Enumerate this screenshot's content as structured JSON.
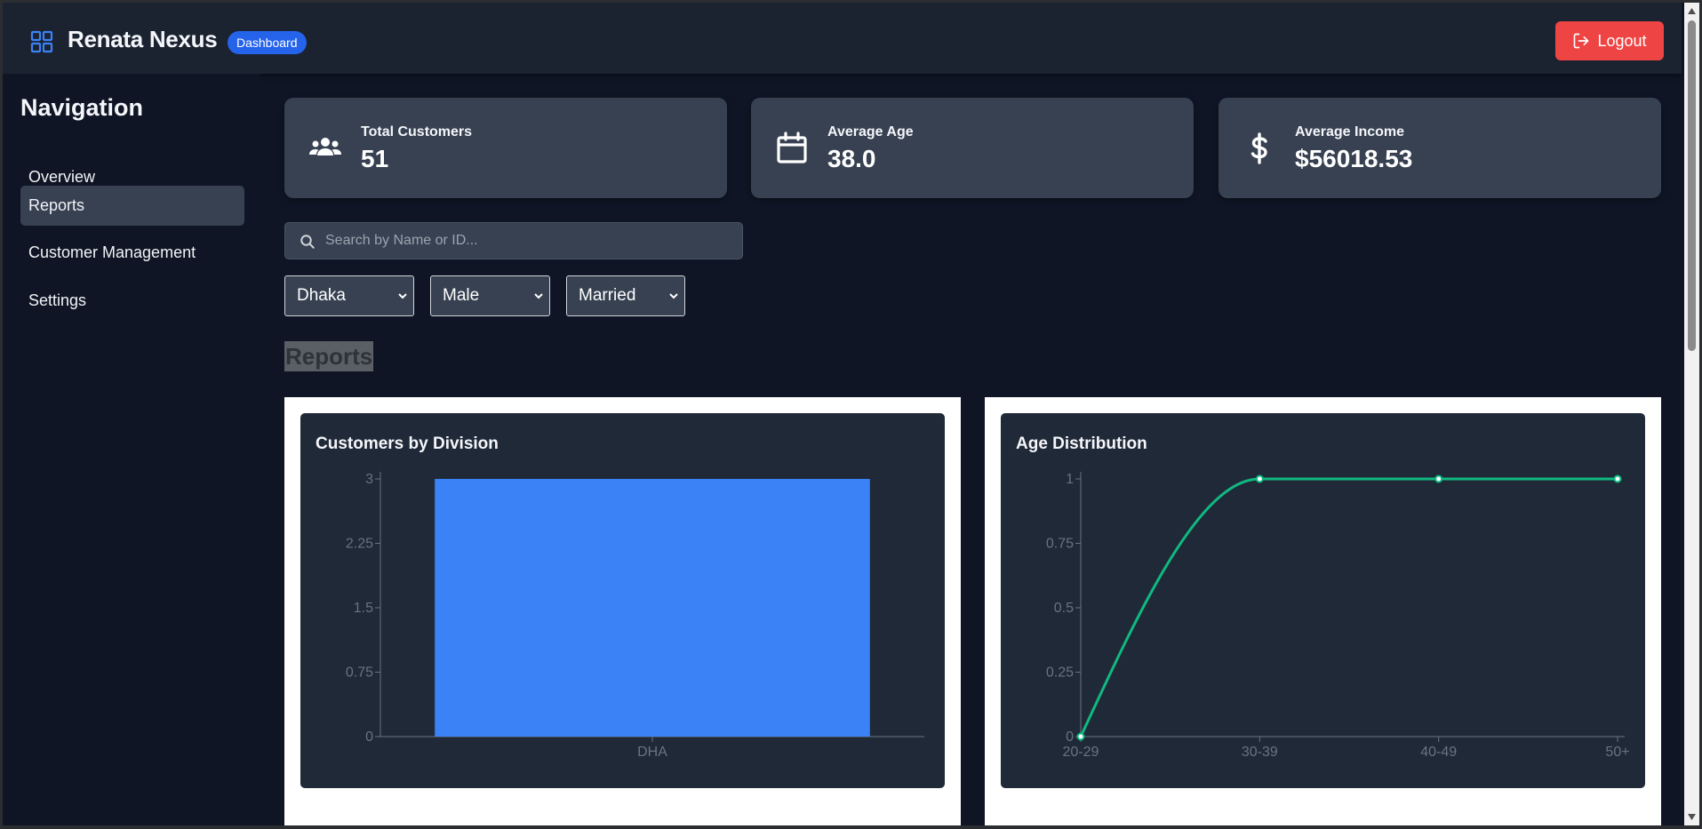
{
  "header": {
    "brand_icon": "grid-icon",
    "title": "Renata Nexus",
    "badge": "Dashboard",
    "logout_label": "Logout",
    "logout_icon": "logout-icon",
    "logout_color": "#ef4444",
    "badge_color": "#2563eb"
  },
  "sidebar": {
    "title": "Navigation",
    "items": [
      {
        "label": "Overview",
        "active": false
      },
      {
        "label": "Reports",
        "active": true
      },
      {
        "label": "Customer Management",
        "active": false
      },
      {
        "label": "Settings",
        "active": false
      }
    ]
  },
  "stats": [
    {
      "icon": "users-icon",
      "label": "Total Customers",
      "value": "51"
    },
    {
      "icon": "calendar-icon",
      "label": "Average Age",
      "value": "38.0"
    },
    {
      "icon": "dollar-icon",
      "label": "Average Income",
      "value": "$56018.53"
    }
  ],
  "filters": {
    "search_placeholder": "Search by Name or ID...",
    "division": "Dhaka",
    "gender": "Male",
    "marital_status": "Married"
  },
  "section_title": "Reports",
  "chart_data": [
    {
      "type": "bar",
      "title": "Customers by Division",
      "categories": [
        "DHA"
      ],
      "values": [
        3
      ],
      "ylim": [
        0,
        3
      ],
      "yticks": [
        "0",
        "0.75",
        "1.5",
        "2.25",
        "3"
      ],
      "color": "#3b82f6"
    },
    {
      "type": "line",
      "title": "Age Distribution",
      "categories": [
        "20-29",
        "30-39",
        "40-49",
        "50+"
      ],
      "values": [
        0,
        1,
        1,
        1
      ],
      "ylim": [
        0,
        1
      ],
      "yticks": [
        "0",
        "0.25",
        "0.5",
        "0.75",
        "1"
      ],
      "color": "#10b981"
    }
  ]
}
